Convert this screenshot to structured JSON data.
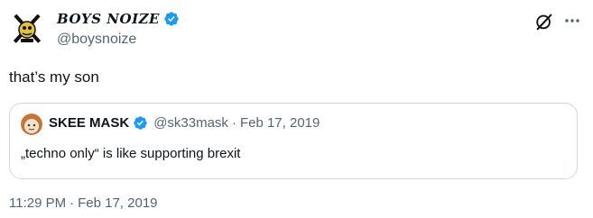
{
  "tweet": {
    "display_name": "BOYS NOIZE",
    "handle": "@boysnoize",
    "text": "that’s my son",
    "time": "11:29 PM",
    "separator": "·",
    "date": "Feb 17, 2019"
  },
  "quote": {
    "display_name": "SKEE MASK",
    "handle": "@sk33mask",
    "separator": "·",
    "date": "Feb 17, 2019",
    "text": "„techno only“ is like supporting brexit"
  },
  "icons": {
    "verified": "verified-badge-icon",
    "grok": "grok-icon",
    "more": "more-options-icon"
  },
  "colors": {
    "verified_blue": "#1d9bf0",
    "text_primary": "#0f1419",
    "text_secondary": "#536471",
    "border": "#cfd9de"
  }
}
